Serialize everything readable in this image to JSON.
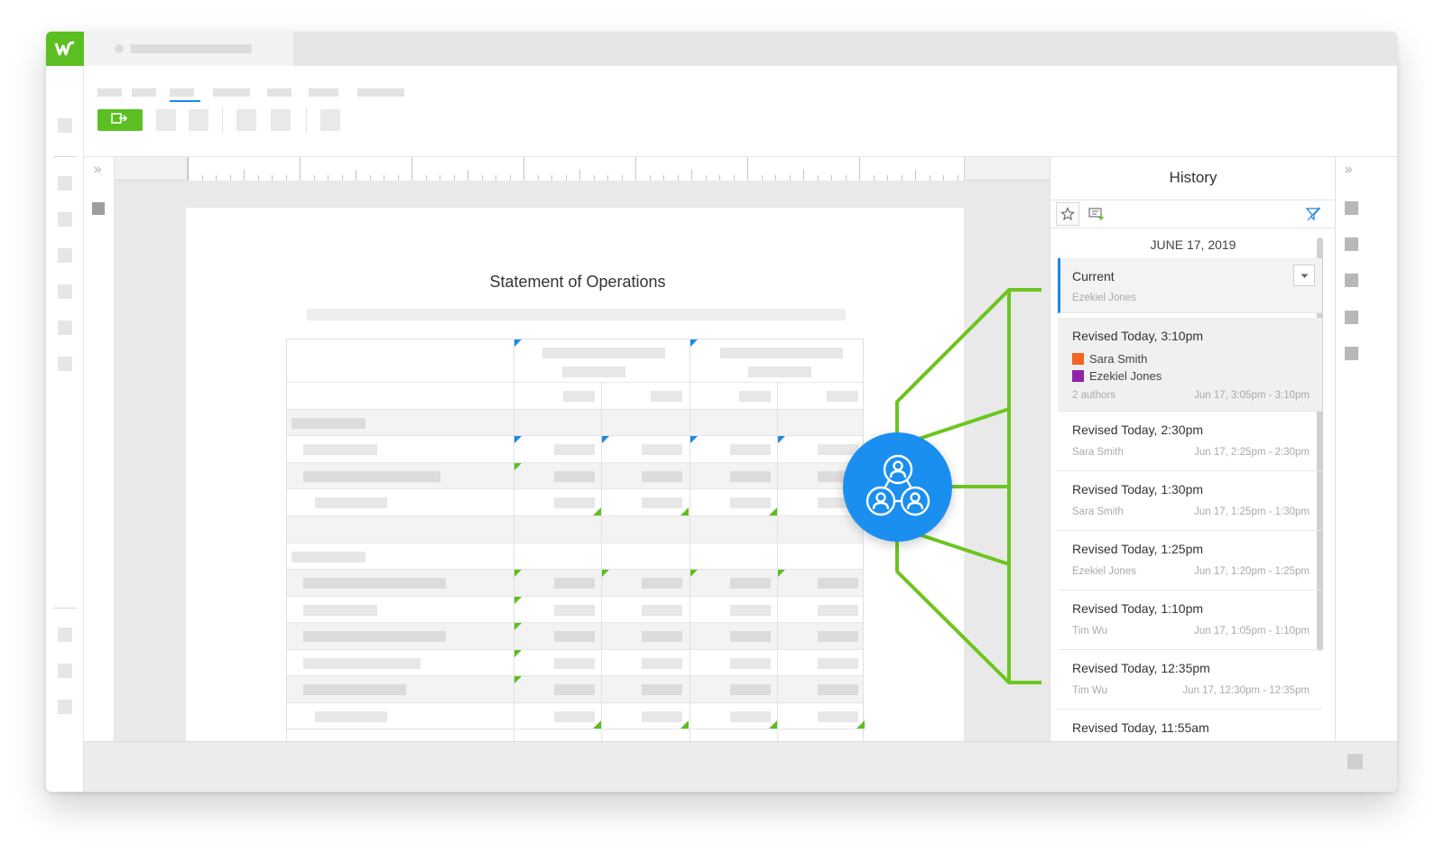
{
  "app": {
    "brand_color": "#5bbf21",
    "accent_color": "#1e88e5",
    "logo_icon": "workiva-w-logo"
  },
  "toolbar": {
    "primary_icon": "export-icon"
  },
  "document": {
    "title": "Statement of Operations"
  },
  "history": {
    "title": "History",
    "tools": [
      "star-icon",
      "add-comment-icon",
      "filter-icon"
    ],
    "date_header": "JUNE 17, 2019",
    "current": {
      "label": "Current",
      "author": "Ezekiel Jones"
    },
    "revisions": [
      {
        "title": "Revised Today, 3:10pm",
        "authors": [
          {
            "name": "Sara Smith",
            "color": "#f26522"
          },
          {
            "name": "Ezekiel Jones",
            "color": "#8e24aa"
          }
        ],
        "author_summary": "2 authors",
        "time_range": "Jun 17, 3:05pm - 3:10pm"
      },
      {
        "title": "Revised Today, 2:30pm",
        "author": "Sara Smith",
        "time_range": "Jun 17, 2:25pm - 2:30pm"
      },
      {
        "title": "Revised Today, 1:30pm",
        "author": "Sara Smith",
        "time_range": "Jun 17, 1:25pm - 1:30pm"
      },
      {
        "title": "Revised Today, 1:25pm",
        "author": "Ezekiel Jones",
        "time_range": "Jun 17, 1:20pm - 1:25pm"
      },
      {
        "title": "Revised Today, 1:10pm",
        "author": "Tim Wu",
        "time_range": "Jun 17, 1:05pm - 1:10pm"
      },
      {
        "title": "Revised Today, 12:35pm",
        "author": "Tim Wu",
        "time_range": "Jun 17, 12:30pm - 12:35pm"
      },
      {
        "title": "Revised Today, 11:55am"
      }
    ]
  },
  "overlay": {
    "collab_icon": "collaboration-users-icon",
    "line_color": "#6cc520"
  }
}
